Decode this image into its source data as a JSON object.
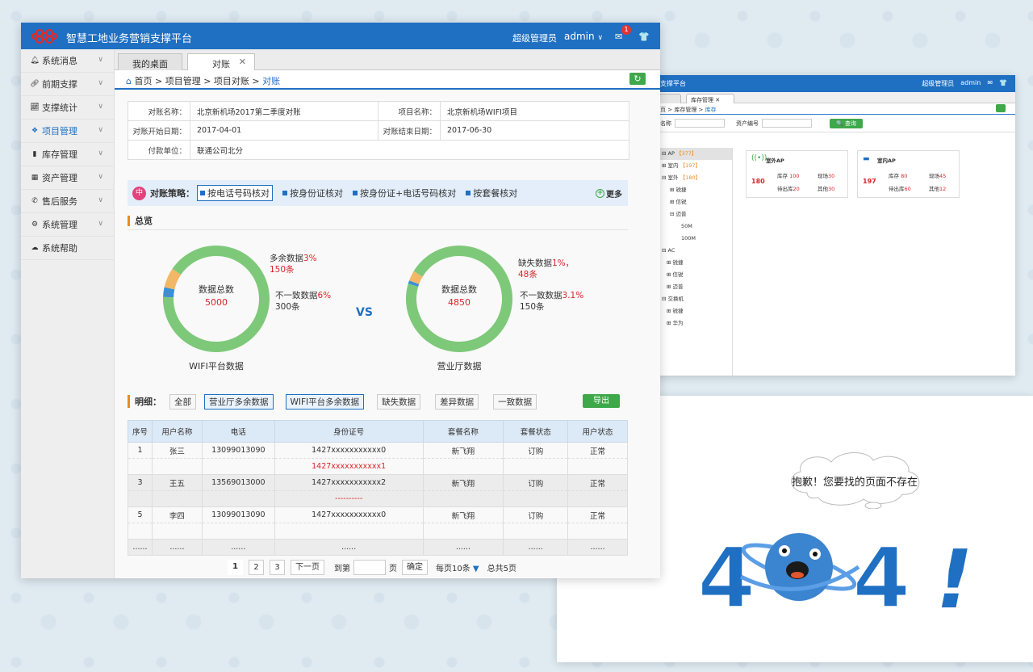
{
  "app_title": "智慧工地业务营销支撑平台",
  "header": {
    "role": "超级管理员",
    "user": "admin",
    "mail_count": "1"
  },
  "sidebar": {
    "items": [
      {
        "label": "系统消息",
        "icon": "bell-icon"
      },
      {
        "label": "前期支撑",
        "icon": "link-icon"
      },
      {
        "label": "支撑统计",
        "icon": "line-chart-icon"
      },
      {
        "label": "项目管理",
        "icon": "dropbox-icon"
      },
      {
        "label": "库存管理",
        "icon": "bar-chart-icon"
      },
      {
        "label": "资产管理",
        "icon": "asset-icon"
      },
      {
        "label": "售后服务",
        "icon": "phone-icon"
      },
      {
        "label": "系统管理",
        "icon": "gear-icon"
      },
      {
        "label": "系统帮助",
        "icon": "help-icon"
      }
    ]
  },
  "tabs": [
    {
      "label": "我的桌面"
    },
    {
      "label": "对账"
    }
  ],
  "breadcrumb": {
    "home": "首页",
    "sep": ">",
    "b1": "项目管理",
    "b2": "项目对账",
    "current": "对账"
  },
  "info": {
    "r1": {
      "k1": "对账名称：",
      "v1": "北京新机场2017第二季度对账",
      "k2": "项目名称：",
      "v2": "北京新机场WIFI项目"
    },
    "r2": {
      "k1": "对账开始日期：",
      "v1": "2017-04-01",
      "k2": "对账结束日期：",
      "v2": "2017-06-30"
    },
    "r3": {
      "k1": "付款单位：",
      "v1": "联通公司北分"
    }
  },
  "strategy": {
    "label": "对账策略：",
    "options": [
      "按电话号码核对",
      "按身份证核对",
      "按身份证+电话号码核对",
      "按套餐核对"
    ],
    "more": "更多"
  },
  "overview": {
    "title": "总览",
    "vs": "VS",
    "left": {
      "center_label": "数据总数",
      "center_value": "5000",
      "caption": "WIFI平台数据",
      "l1_name": "多余数据",
      "l1_pct": "3%",
      "l1_count": "150条",
      "l2_name": "不一致数据",
      "l2_pct": "6%",
      "l2_count": "300条"
    },
    "right": {
      "center_label": "数据总数",
      "center_value": "4850",
      "caption": "营业厅数据",
      "l1_name": "缺失数据",
      "l1_pct": "1%，",
      "l1_count": "48条",
      "l2_name": "不一致数据",
      "l2_pct": "3.1%",
      "l2_count": "150条"
    }
  },
  "chart_data": [
    {
      "type": "pie",
      "categories": [
        "一致",
        "多余数据",
        "不一致数据"
      ],
      "values": [
        91,
        3,
        6
      ],
      "colors": [
        "#7ec979",
        "#3b8fd6",
        "#f2b867"
      ]
    },
    {
      "type": "pie",
      "categories": [
        "一致",
        "缺失数据",
        "不一致数据"
      ],
      "values": [
        95.9,
        1,
        3.1
      ],
      "colors": [
        "#7ec979",
        "#3b8fd6",
        "#f2b867"
      ]
    }
  ],
  "detail": {
    "label": "明细：",
    "filters": [
      "全部",
      "营业厅多余数据",
      "WIFI平台多余数据",
      "缺失数据",
      "差异数据",
      "一致数据"
    ],
    "export": "导出"
  },
  "table": {
    "headers": [
      "序号",
      "用户名称",
      "电话",
      "身份证号",
      "套餐名称",
      "套餐状态",
      "用户状态"
    ],
    "rows": [
      {
        "no": "1",
        "name": "张三",
        "phone": "13099013090",
        "id": "1427xxxxxxxxxxx0",
        "id2": "1427xxxxxxxxxxx1",
        "plan": "新飞翔",
        "status": "订购",
        "user": "正常"
      },
      {
        "no": "3",
        "name": "王五",
        "phone": "13569013000",
        "id": "1427xxxxxxxxxxx2",
        "id2": "----------",
        "plan": "新飞翔",
        "status": "订购",
        "user": "正常"
      },
      {
        "no": "5",
        "name": "李四",
        "phone": "13099013090",
        "id": "1427xxxxxxxxxxx0",
        "plan": "新飞翔",
        "status": "订购",
        "user": "正常"
      },
      {
        "no": "......",
        "name": "......",
        "phone": "......",
        "id": "......",
        "plan": "......",
        "status": "......",
        "user": "......"
      }
    ]
  },
  "pager": {
    "p1": "1",
    "p2": "2",
    "p3": "3",
    "next": "下一页",
    "goto": "到第",
    "page": "页",
    "ok": "确定",
    "per_page": "每页10条",
    "total": "总共5页"
  },
  "win2": {
    "title": "支撑平台",
    "role": "超级管理员",
    "user": "admin",
    "tab1": "面",
    "tab2": "库存管理",
    "bc": "页 > 库存管理 >",
    "bc_current": "库存",
    "search1": "名称",
    "search2": "资产编号",
    "search_btn": "查询",
    "tree": [
      {
        "t": "⊟ AP",
        "n": "【377】"
      },
      {
        "t": "⊞ 室内",
        "n": "【197】"
      },
      {
        "t": "⊟ 室外",
        "n": "【180】"
      },
      {
        "t": "⊞ 锐捷"
      },
      {
        "t": "⊞ 信锐"
      },
      {
        "t": "⊟ 迈普"
      },
      {
        "t": "50M"
      },
      {
        "t": "100M"
      },
      {
        "t": "⊟ AC"
      },
      {
        "t": "⊞ 锐捷"
      },
      {
        "t": "⊞ 信锐"
      },
      {
        "t": "⊞ 迈普"
      },
      {
        "t": "⊟ 交换机"
      },
      {
        "t": "⊞ 锐捷"
      },
      {
        "t": "⊞ 华为"
      }
    ],
    "cards": [
      {
        "title": "室外AP",
        "total": "180",
        "k1": "库存",
        "v1": "100",
        "k2": "现场",
        "v2": "30",
        "k3": "待出库",
        "v3": "20",
        "k4": "其他",
        "v4": "30"
      },
      {
        "title": "室内AP",
        "total": "197",
        "k1": "库存",
        "v1": "80",
        "k2": "现场",
        "v2": "45",
        "k3": "待出库",
        "v3": "60",
        "k4": "其他",
        "v4": "12"
      }
    ]
  },
  "p404": {
    "message": "抱歉！您要找的页面不存在"
  }
}
